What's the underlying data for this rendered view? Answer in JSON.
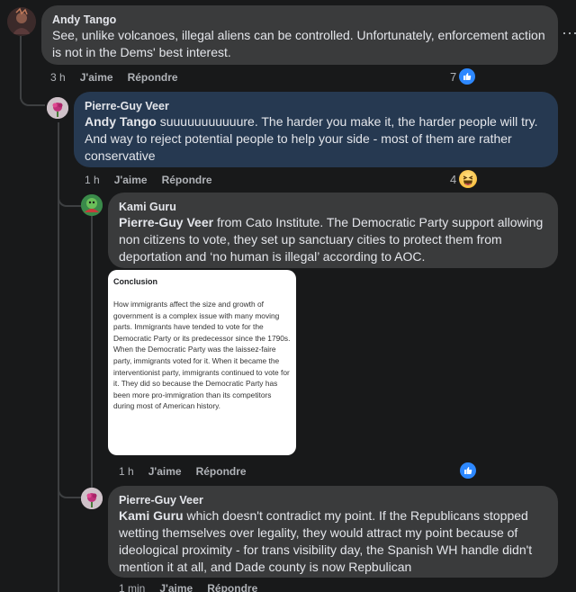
{
  "comments": [
    {
      "author": "Andy Tango",
      "text": "See, unlike volcanoes, illegal aliens can be controlled. Unfortunately, enforcement action is not in the Dems' best interest.",
      "time": "3 h",
      "like_label": "J'aime",
      "reply_label": "Répondre",
      "reaction_count": "7",
      "reaction": "like"
    },
    {
      "author": "Pierre-Guy Veer",
      "mention": "Andy Tango",
      "text": " suuuuuuuuuuure. The harder you make it, the harder people will try. And way to reject potential people to help your side - most of them are rather conservative",
      "time": "1 h",
      "like_label": "J'aime",
      "reply_label": "Répondre",
      "reaction_count": "4",
      "reaction": "haha"
    },
    {
      "author": "Kami Guru",
      "mention": "Pierre-Guy Veer",
      "text": " from Cato Institute. The Democratic Party support allowing non citizens to vote, they set up sanctuary cities to protect them from deportation and ‘no human is illegal’ according to AOC.",
      "time": "1 h",
      "like_label": "J'aime",
      "reply_label": "Répondre",
      "reaction": "like",
      "attachment": {
        "title": "Conclusion",
        "body": "How immigrants affect the size and growth of government is a complex issue with many moving parts. Immigrants have tended to vote for the Democratic Party or its predecessor since the 1790s. When the Democratic Party was the laissez-faire party, immigrants voted for it. When it became the interventionist party, immigrants continued to vote for it. They did so because the Democratic Party has been more pro-immigration than its competitors during most of American history."
      }
    },
    {
      "author": "Pierre-Guy Veer",
      "mention": "Kami Guru",
      "text": " which doesn't contradict my point. If the Republicans stopped wetting themselves over legality, they would attract my point because of ideological proximity - for trans visibility day, the Spanish WH handle didn't mention it at all, and Dade county is now Repbulican",
      "time": "1 min",
      "like_label": "J'aime",
      "reply_label": "Répondre"
    }
  ],
  "colors": {
    "background": "#18191a",
    "bubble": "#3a3b3c",
    "highlight_bubble": "#263951",
    "like_blue": "#2d88ff"
  },
  "icons": [
    "more-options-icon",
    "like-reaction-icon",
    "haha-reaction-icon"
  ]
}
